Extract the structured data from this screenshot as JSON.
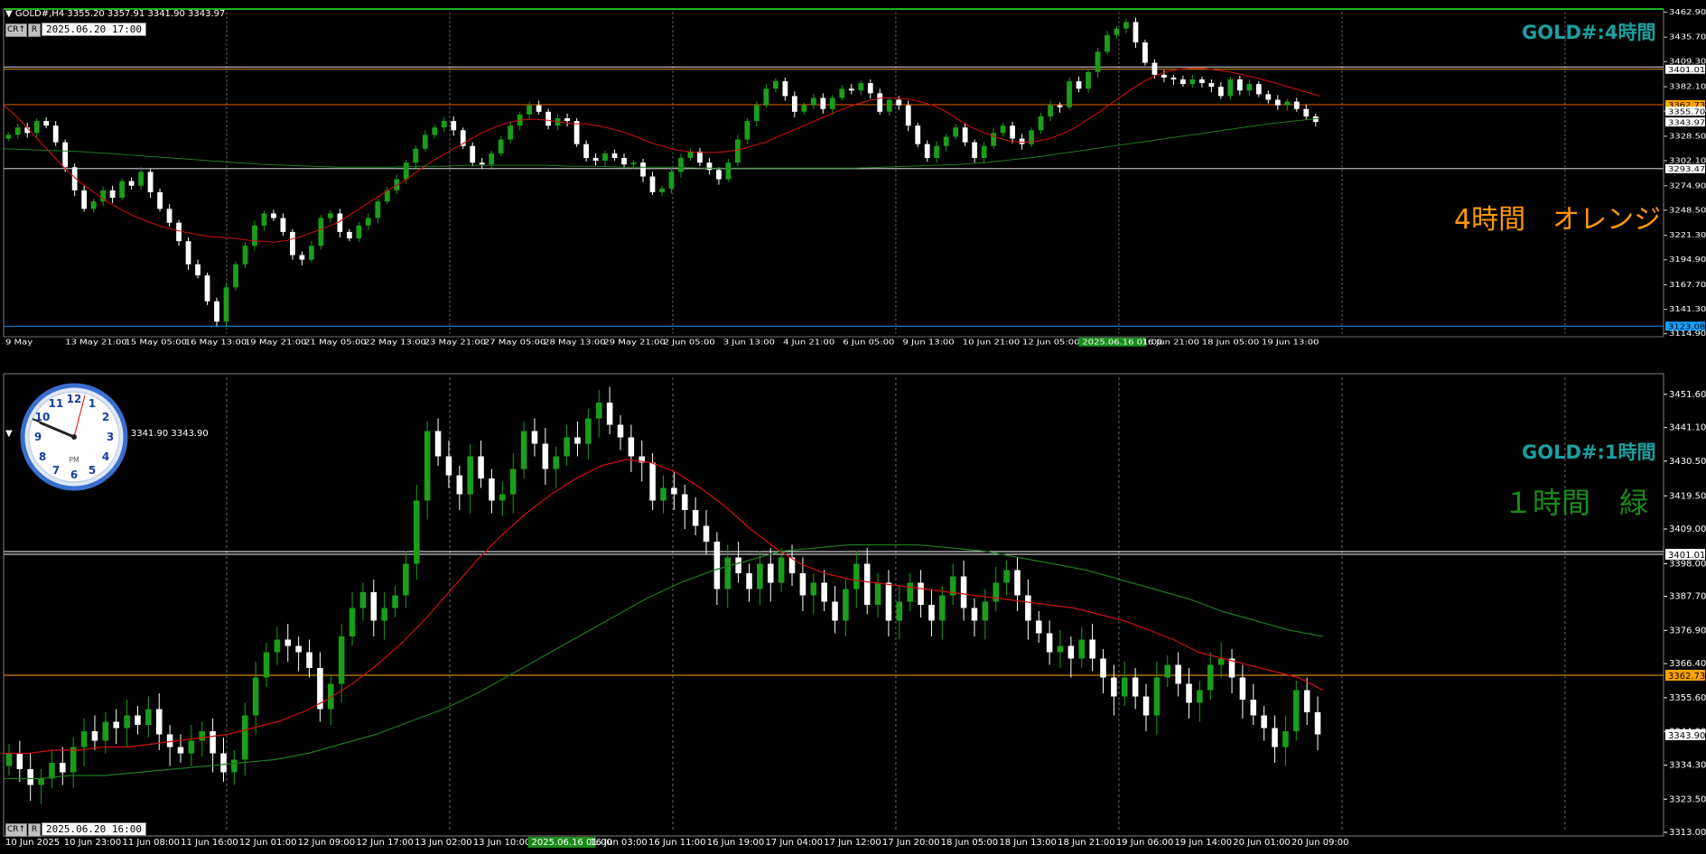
{
  "top_panel": {
    "header": "GOLD#,H4  3355.20 3357.91 3341.90 3343.97",
    "buttons": [
      "CR↑",
      "R"
    ],
    "cursor_time": "2025.06.20 17:00",
    "title": "GOLD#:4時間",
    "annotation": "4時間　オレンジ"
  },
  "bottom_panel": {
    "header": "3341.90 3343.90",
    "buttons": [
      "CR↑",
      "R"
    ],
    "cursor_time": "2025.06.20 16:00",
    "title": "GOLD#:1時間",
    "annotation": "１時間　緑"
  },
  "colors": {
    "background": "#000000",
    "bull": "#1a9e1a",
    "bear": "#ffffff",
    "ma_red": "#d01010",
    "ma_green": "#1e7a1e",
    "zigzag": "#ffa500",
    "title": "#1aa0a0",
    "orange_text": "#ff9900",
    "green_text": "#1a8c1a"
  },
  "chart_data": [
    {
      "type": "candlestick",
      "title": "GOLD#:4時間",
      "ylim": [
        3114.9,
        3462.9
      ],
      "y_ticks": [
        "3462.90",
        "3435.70",
        "3409.30",
        "3382.10",
        "3355.70",
        "3328.50",
        "3302.10",
        "3274.90",
        "3248.50",
        "3221.30",
        "3194.90",
        "3167.70",
        "3141.30",
        "3114.90"
      ],
      "x_ticks": [
        "9 May",
        "13 May 21:00",
        "15 May 05:00",
        "16 May 13:00",
        "19 May 21:00",
        "21 May 05:00",
        "22 May 13:00",
        "23 May 21:00",
        "27 May 05:00",
        "28 May 13:00",
        "29 May 21:00",
        "2 Jun 05:00",
        "3 Jun 13:00",
        "4 Jun 21:00",
        "6 Jun 05:00",
        "9 Jun 13:00",
        "10 Jun 21:00",
        "12 Jun 05:00",
        "2025.06.16 01:00",
        "16 Jun 21:00",
        "18 Jun 05:00",
        "19 Jun 13:00"
      ],
      "price_labels": [
        {
          "label": "3401.01",
          "value": 3401.01,
          "color": "#ffffff"
        },
        {
          "label": "3362.73",
          "value": 3362.73,
          "color": "#ffa500"
        },
        {
          "label": "3355.70",
          "value": 3355.7,
          "color": "#ffffff"
        },
        {
          "label": "3343.97",
          "value": 3343.97,
          "color": "#ffffff"
        },
        {
          "label": "3293.47",
          "value": 3293.47,
          "color": "#ffffff"
        },
        {
          "label": "3123.08",
          "value": 3123.08,
          "color": "#1aa0ff"
        }
      ],
      "horizontal_lines": [
        {
          "value": 3401.01,
          "color": "#ffa500"
        },
        {
          "value": 3362.73,
          "color": "#ff6a00"
        },
        {
          "value": 3293.47,
          "color": "#ffffff"
        },
        {
          "value": 3123.08,
          "color": "#1aa0ff"
        }
      ],
      "close_path": [
        3330,
        3338,
        3332,
        3345,
        3340,
        3322,
        3295,
        3270,
        3250,
        3258,
        3270,
        3262,
        3280,
        3275,
        3290,
        3268,
        3250,
        3235,
        3215,
        3190,
        3178,
        3150,
        3128,
        3165,
        3190,
        3210,
        3232,
        3245,
        3240,
        3225,
        3200,
        3195,
        3210,
        3240,
        3245,
        3225,
        3218,
        3232,
        3240,
        3258,
        3270,
        3282,
        3300,
        3315,
        3330,
        3338,
        3345,
        3335,
        3318,
        3300,
        3298,
        3310,
        3325,
        3340,
        3352,
        3362,
        3355,
        3340,
        3348,
        3345,
        3320,
        3305,
        3302,
        3310,
        3305,
        3298,
        3300,
        3285,
        3268,
        3272,
        3290,
        3305,
        3312,
        3300,
        3292,
        3282,
        3300,
        3325,
        3345,
        3362,
        3380,
        3388,
        3372,
        3355,
        3362,
        3370,
        3358,
        3370,
        3380,
        3378,
        3386,
        3375,
        3355,
        3368,
        3362,
        3340,
        3320,
        3305,
        3318,
        3328,
        3338,
        3322,
        3305,
        3318,
        3332,
        3340,
        3326,
        3320,
        3335,
        3350,
        3362,
        3360,
        3388,
        3380,
        3398,
        3420,
        3438,
        3445,
        3452,
        3430,
        3408,
        3395,
        3392,
        3390,
        3385,
        3390,
        3386,
        3382,
        3372,
        3390,
        3378,
        3385,
        3374,
        3368,
        3362,
        3366,
        3358,
        3350,
        3344
      ],
      "series": [
        {
          "name": "MA red",
          "values": [
            3362,
            3350,
            3335,
            3320,
            3305,
            3290,
            3278,
            3268,
            3258,
            3250,
            3243,
            3237,
            3232,
            3228,
            3225,
            3222,
            3220,
            3219,
            3218,
            3216,
            3215,
            3214,
            3216,
            3220,
            3225,
            3230,
            3236,
            3245,
            3254,
            3263,
            3272,
            3280,
            3290,
            3300,
            3308,
            3316,
            3324,
            3332,
            3338,
            3343,
            3346,
            3347,
            3346,
            3344,
            3342,
            3342,
            3340,
            3337,
            3333,
            3328,
            3322,
            3318,
            3314,
            3312,
            3311,
            3311,
            3312,
            3314,
            3318,
            3322,
            3328,
            3334,
            3340,
            3346,
            3352,
            3358,
            3363,
            3367,
            3370,
            3370,
            3369,
            3366,
            3362,
            3355,
            3346,
            3338,
            3332,
            3327,
            3323,
            3322,
            3323,
            3326,
            3331,
            3338,
            3347,
            3356,
            3366,
            3376,
            3385,
            3393,
            3398,
            3401,
            3402,
            3402,
            3400,
            3398,
            3395,
            3392,
            3388,
            3384,
            3380,
            3376,
            3372
          ]
        },
        {
          "name": "MA green",
          "values": [
            3315,
            3314,
            3313,
            3312,
            3310,
            3308,
            3306,
            3304,
            3302,
            3300,
            3298,
            3297,
            3296,
            3295,
            3295,
            3295,
            3296,
            3296,
            3297,
            3297,
            3297,
            3297,
            3296,
            3296,
            3295,
            3295,
            3295,
            3294,
            3294,
            3294,
            3294,
            3294,
            3294,
            3294,
            3295,
            3296,
            3297,
            3298,
            3300,
            3303,
            3306,
            3310,
            3314,
            3318,
            3322,
            3326,
            3330,
            3334,
            3338,
            3342,
            3345,
            3348
          ]
        }
      ]
    },
    {
      "type": "candlestick",
      "title": "GOLD#:1時間",
      "ylim": [
        3313.0,
        3457.0
      ],
      "y_ticks": [
        "3451.60",
        "3441.10",
        "3430.50",
        "3419.50",
        "3409.00",
        "3398.00",
        "3387.70",
        "3376.90",
        "3366.40",
        "3355.60",
        "3344.90",
        "3334.30",
        "3323.50",
        "3313.00"
      ],
      "x_ticks": [
        "10 Jun 2025",
        "10 Jun 23:00",
        "11 Jun 08:00",
        "11 Jun 16:00",
        "12 Jun 01:00",
        "12 Jun 09:00",
        "12 Jun 17:00",
        "13 Jun 02:00",
        "13 Jun 10:00",
        "2025.06.16 01:00",
        "16 Jun 03:00",
        "16 Jun 11:00",
        "16 Jun 19:00",
        "17 Jun 04:00",
        "17 Jun 12:00",
        "17 Jun 20:00",
        "18 Jun 05:00",
        "18 Jun 13:00",
        "18 Jun 21:00",
        "19 Jun 06:00",
        "19 Jun 14:00",
        "20 Jun 01:00",
        "20 Jun 09:00"
      ],
      "price_labels": [
        {
          "label": "3401.01",
          "value": 3401.01,
          "color": "#ffffff"
        },
        {
          "label": "3362.73",
          "value": 3362.73,
          "color": "#ffa500"
        },
        {
          "label": "3343.90",
          "value": 3343.9,
          "color": "#ffffff"
        }
      ],
      "horizontal_lines": [
        {
          "value": 3401.01,
          "color": "#ffffff"
        },
        {
          "value": 3362.73,
          "color": "#ffa500"
        }
      ],
      "close_path": [
        3338,
        3333,
        3328,
        3330,
        3335,
        3332,
        3340,
        3345,
        3342,
        3348,
        3346,
        3350,
        3347,
        3352,
        3344,
        3340,
        3338,
        3342,
        3345,
        3338,
        3332,
        3336,
        3350,
        3362,
        3370,
        3374,
        3372,
        3370,
        3365,
        3352,
        3360,
        3375,
        3384,
        3389,
        3380,
        3384,
        3388,
        3398,
        3418,
        3440,
        3432,
        3426,
        3420,
        3432,
        3425,
        3418,
        3420,
        3428,
        3440,
        3436,
        3428,
        3432,
        3438,
        3436,
        3444,
        3449,
        3442,
        3438,
        3432,
        3430,
        3418,
        3422,
        3420,
        3415,
        3410,
        3405,
        3390,
        3400,
        3395,
        3390,
        3398,
        3392,
        3400,
        3395,
        3388,
        3392,
        3386,
        3380,
        3390,
        3398,
        3385,
        3392,
        3380,
        3386,
        3392,
        3385,
        3380,
        3388,
        3394,
        3384,
        3380,
        3386,
        3392,
        3396,
        3388,
        3380,
        3376,
        3370,
        3372,
        3368,
        3374,
        3368,
        3362,
        3356,
        3362,
        3356,
        3350,
        3362,
        3366,
        3360,
        3354,
        3358,
        3366,
        3368,
        3362,
        3355,
        3350,
        3346,
        3340,
        3345,
        3358,
        3351,
        3344
      ],
      "series": [
        {
          "name": "MA red",
          "values": [
            3338,
            3338,
            3339,
            3339,
            3340,
            3340,
            3341,
            3342,
            3343,
            3344,
            3346,
            3348,
            3351,
            3355,
            3360,
            3366,
            3373,
            3381,
            3390,
            3399,
            3407,
            3414,
            3420,
            3425,
            3429,
            3431,
            3430,
            3427,
            3422,
            3416,
            3409,
            3403,
            3398,
            3395,
            3393,
            3392,
            3391,
            3390,
            3389,
            3388,
            3387,
            3386,
            3385,
            3384,
            3382,
            3380,
            3377,
            3374,
            3370,
            3368,
            3366,
            3364,
            3362,
            3358
          ]
        },
        {
          "name": "MA green",
          "values": [
            3330,
            3330,
            3331,
            3331,
            3332,
            3333,
            3334,
            3335,
            3336,
            3338,
            3341,
            3344,
            3348,
            3352,
            3357,
            3363,
            3369,
            3375,
            3381,
            3387,
            3392,
            3396,
            3399,
            3402,
            3403,
            3404,
            3404,
            3404,
            3403,
            3402,
            3400,
            3398,
            3396,
            3393,
            3390,
            3387,
            3383,
            3380,
            3377,
            3375
          ]
        }
      ]
    }
  ]
}
